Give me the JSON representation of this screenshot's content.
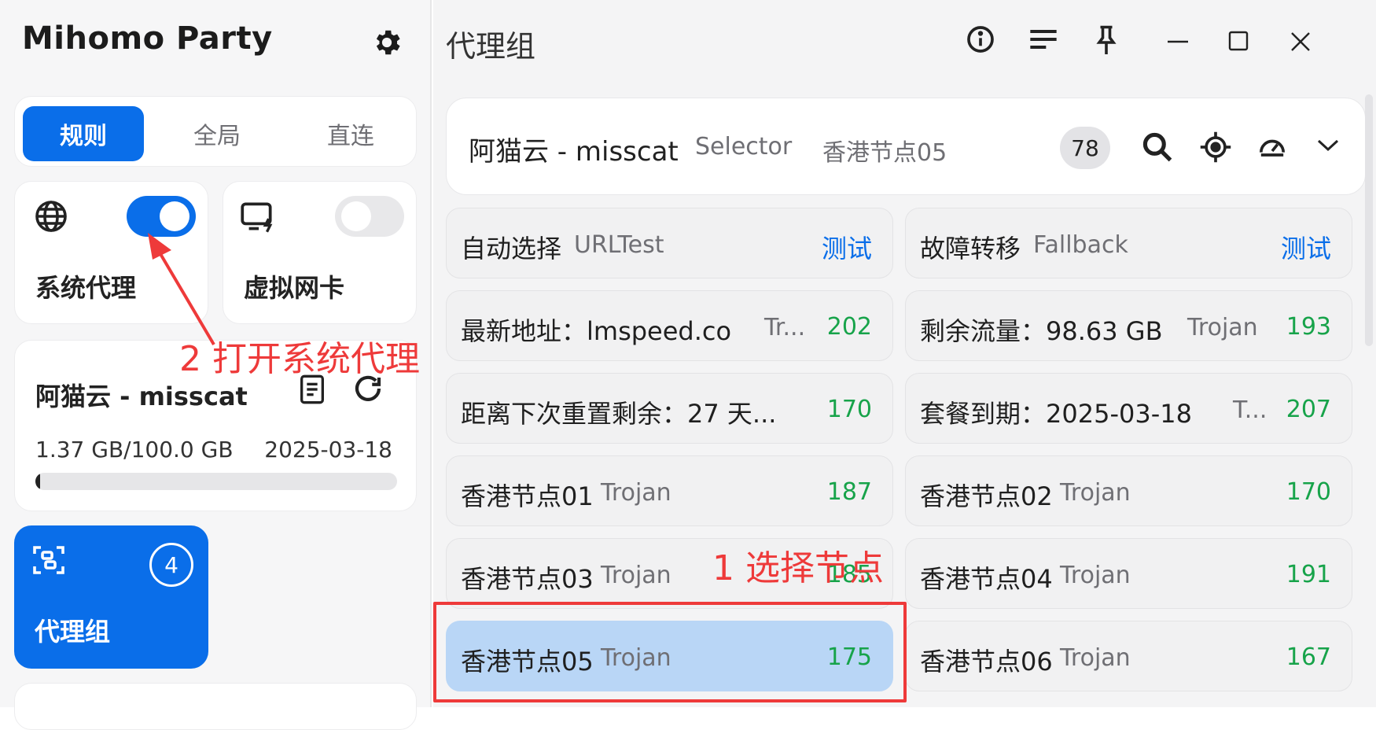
{
  "app": {
    "title": "Mihomo Party"
  },
  "modes": {
    "rule": "规则",
    "global": "全局",
    "direct": "直连"
  },
  "tiles": {
    "system_proxy": {
      "label": "系统代理",
      "enabled": true
    },
    "tun": {
      "label": "虚拟网卡",
      "enabled": false
    },
    "proxy_group": {
      "label": "代理组",
      "badge": "4"
    }
  },
  "subscription": {
    "name": "阿猫云 - misscat",
    "usage": "1.37 GB/100.0 GB",
    "expire": "2025-03-18",
    "used_fraction": 0.0137
  },
  "header": {
    "title": "代理组"
  },
  "group": {
    "name": "阿猫云 - misscat",
    "type": "Selector",
    "current": "香港节点05",
    "count": "78"
  },
  "proxies": [
    {
      "name": "自动选择",
      "type": "URLTest",
      "action": "测试"
    },
    {
      "name": "故障转移",
      "type": "Fallback",
      "action": "测试"
    },
    {
      "name": "最新地址：lmspeed.co",
      "type": "Tr...",
      "delay": "202"
    },
    {
      "name": "剩余流量：98.63 GB",
      "type": "Trojan",
      "delay": "193"
    },
    {
      "name": "距离下次重置剩余：27 天...",
      "type": "",
      "delay": "170"
    },
    {
      "name": "套餐到期：2025-03-18",
      "type": "T...",
      "delay": "207"
    },
    {
      "name": "香港节点01",
      "type": "Trojan",
      "delay": "187"
    },
    {
      "name": "香港节点02",
      "type": "Trojan",
      "delay": "170"
    },
    {
      "name": "香港节点03",
      "type": "Trojan",
      "delay": "185"
    },
    {
      "name": "香港节点04",
      "type": "Trojan",
      "delay": "191"
    },
    {
      "name": "香港节点05",
      "type": "Trojan",
      "delay": "175",
      "selected": true
    },
    {
      "name": "香港节点06",
      "type": "Trojan",
      "delay": "167"
    }
  ],
  "annotations": {
    "open_system_proxy": "2 打开系统代理",
    "select_node": "1 选择节点"
  },
  "colors": {
    "accent": "#0a6ee9",
    "delay": "#17a34a",
    "annotation": "#ee3a3a",
    "selected_bg": "#b9d6f6"
  },
  "icons": {
    "settings": "gear-icon",
    "globe": "globe-icon",
    "tun": "network-card-icon",
    "doc": "document-icon",
    "refresh": "refresh-icon",
    "group": "scan-icon"
  }
}
